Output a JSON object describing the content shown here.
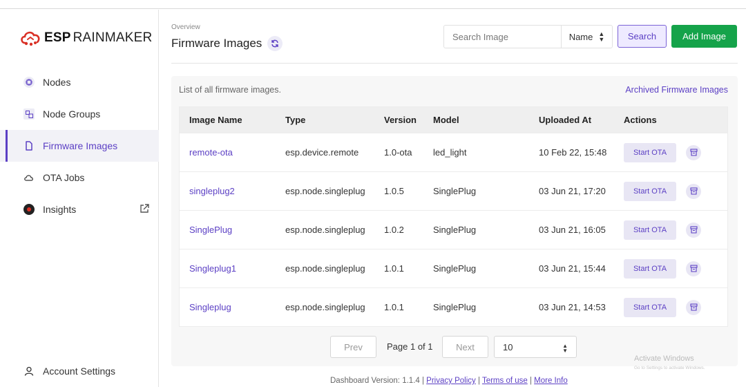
{
  "app": {
    "brand_bold": "ESP",
    "brand_rest": "RAINMAKER"
  },
  "sidebar": {
    "items": [
      {
        "label": "Nodes",
        "icon": "chip-icon"
      },
      {
        "label": "Node Groups",
        "icon": "groups-icon"
      },
      {
        "label": "Firmware Images",
        "icon": "file-icon",
        "active": true
      },
      {
        "label": "OTA Jobs",
        "icon": "cloud-icon"
      },
      {
        "label": "Insights",
        "icon": "insights-icon",
        "external": true
      }
    ],
    "account": "Account Settings"
  },
  "header": {
    "breadcrumb": "Overview",
    "title": "Firmware Images",
    "search_placeholder": "Search Image",
    "sort_by": "Name",
    "search_label": "Search",
    "add_label": "Add Image"
  },
  "card": {
    "subtitle": "List of all firmware images.",
    "archived_link": "Archived Firmware Images"
  },
  "table": {
    "columns": [
      "Image Name",
      "Type",
      "Version",
      "Model",
      "Uploaded At",
      "Actions"
    ],
    "action_label": "Start OTA",
    "rows": [
      {
        "name": "remote-ota",
        "type": "esp.device.remote",
        "version": "1.0-ota",
        "model": "led_light",
        "uploaded": "10 Feb 22, 15:48"
      },
      {
        "name": "singleplug2",
        "type": "esp.node.singleplug",
        "version": "1.0.5",
        "model": "SinglePlug",
        "uploaded": "03 Jun 21, 17:20"
      },
      {
        "name": "SinglePlug",
        "type": "esp.node.singleplug",
        "version": "1.0.2",
        "model": "SinglePlug",
        "uploaded": "03 Jun 21, 16:05"
      },
      {
        "name": "Singleplug1",
        "type": "esp.node.singleplug",
        "version": "1.0.1",
        "model": "SinglePlug",
        "uploaded": "03 Jun 21, 15:44"
      },
      {
        "name": "Singleplug",
        "type": "esp.node.singleplug",
        "version": "1.0.1",
        "model": "SinglePlug",
        "uploaded": "03 Jun 21, 14:53"
      }
    ]
  },
  "pagination": {
    "prev": "Prev",
    "info": "Page 1 of 1",
    "next": "Next",
    "page_size": "10"
  },
  "footer": {
    "version": "Dashboard Version: 1.1.4",
    "privacy": "Privacy Policy",
    "terms": "Terms of use",
    "more": "More Info"
  },
  "watermark": {
    "title": "Activate Windows",
    "sub": "Go to Settings to activate Windows."
  },
  "colors": {
    "accent": "#5b3fc4",
    "add_button": "#15a34a",
    "logo_red": "#d93025"
  }
}
